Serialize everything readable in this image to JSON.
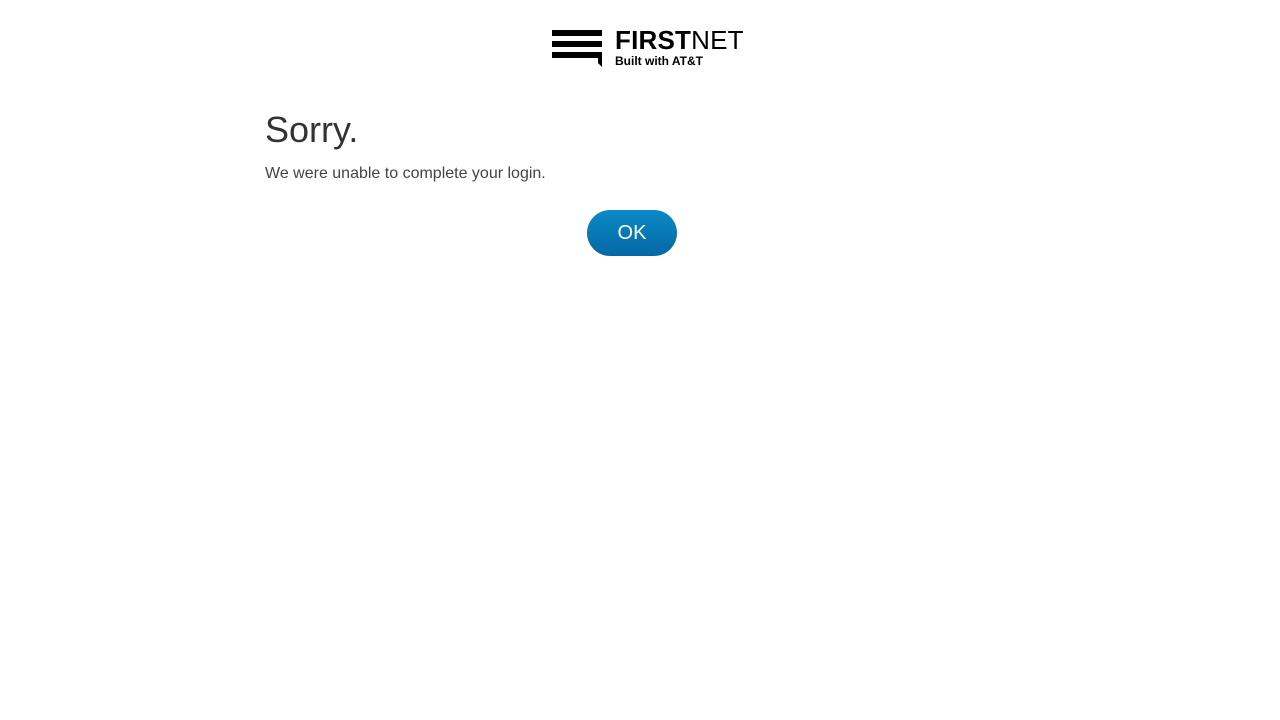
{
  "header": {
    "logo": {
      "icon": "firstnet-logo-icon",
      "word_bold": "FIRST",
      "word_light": "NET",
      "tagline": "Built with AT&T"
    }
  },
  "main": {
    "heading": "Sorry.",
    "message": "We were unable to complete your login.",
    "ok_label": "OK"
  },
  "colors": {
    "button_top": "#0a8ac6",
    "button_bottom": "#0568a6",
    "heading_text": "#333333",
    "body_text": "#444444"
  }
}
